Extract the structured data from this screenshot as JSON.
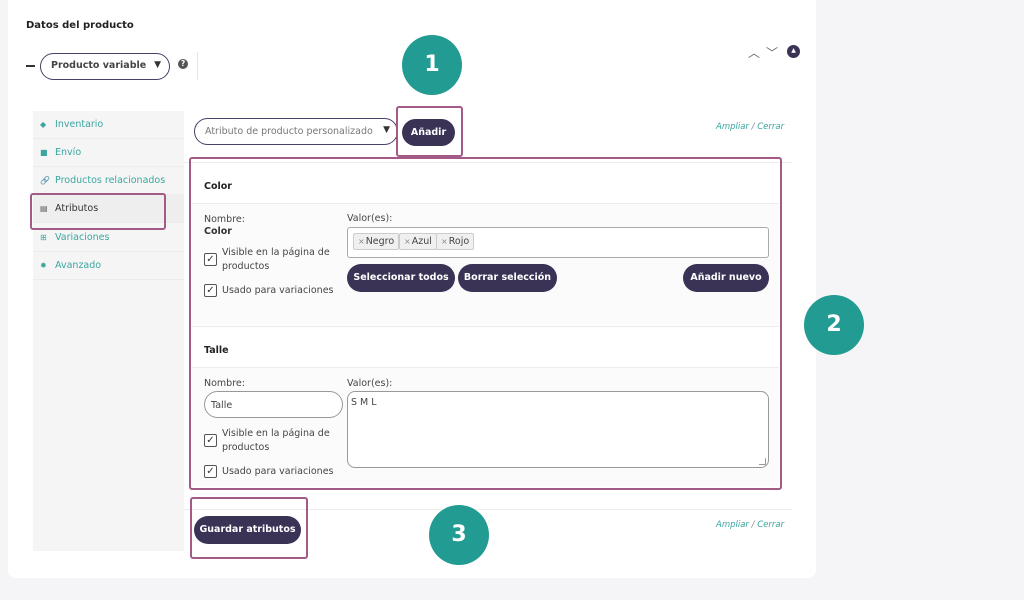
{
  "panel_title": "Datos del producto",
  "product_type": {
    "dash": "—",
    "value": "Producto variable",
    "caret": "▼",
    "help": "?"
  },
  "header_controls": {
    "up": "︿",
    "down": "﹀",
    "toggle": "▲"
  },
  "sidebar": {
    "items": [
      {
        "icon": "◆",
        "icon_name": "diamond-icon",
        "label": "Inventario"
      },
      {
        "icon": "■",
        "icon_name": "truck-icon",
        "label": "Envío"
      },
      {
        "icon": "🔗",
        "icon_name": "link-icon",
        "label": "Productos relacionados"
      },
      {
        "icon": "▤",
        "icon_name": "table-icon",
        "label": "Atributos"
      },
      {
        "icon": "⊞",
        "icon_name": "grid-icon",
        "label": "Variaciones"
      },
      {
        "icon": "✹",
        "icon_name": "gear-icon",
        "label": "Avanzado"
      }
    ],
    "active_index": 3
  },
  "attribute_select": {
    "value": "Atributo de producto personalizado",
    "caret": "▼"
  },
  "add_button": "Añadir",
  "expand_link": {
    "expand": "Ampliar",
    "sep": " / ",
    "close": "Cerrar"
  },
  "color_section": {
    "title": "Color",
    "name_label": "Nombre:",
    "name_value": "Color",
    "values_label": "Valor(es):",
    "tags": [
      "Negro",
      "Azul",
      "Rojo"
    ],
    "tag_remove": "×",
    "visible_label": "Visible en la página de productos",
    "variations_label": "Usado para variaciones",
    "check": "✓",
    "select_all": "Seleccionar todos",
    "clear": "Borrar selección",
    "add_new": "Añadir nuevo"
  },
  "size_section": {
    "title": "Talle",
    "name_label": "Nombre:",
    "name_value": "Talle",
    "values_label": "Valor(es):",
    "values_text": "S M L",
    "visible_label": "Visible en la página de productos",
    "variations_label": "Usado para variaciones",
    "check": "✓"
  },
  "save_button": "Guardar atributos",
  "badges": [
    "1",
    "2",
    "3"
  ],
  "colors": {
    "accent": "#3a3356",
    "teal": "#229b92",
    "highlight": "#a35a86",
    "link": "#3aa6a0"
  }
}
